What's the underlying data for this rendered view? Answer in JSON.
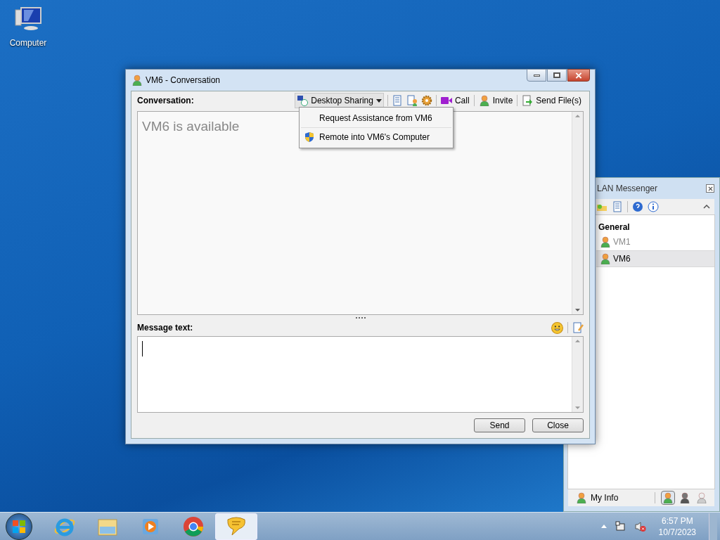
{
  "desktop_icons": [
    {
      "label": "Computer"
    }
  ],
  "messenger_window": {
    "title": "LAN Messenger",
    "group": "General",
    "contacts": [
      {
        "name": "VM1",
        "offline": true,
        "selected": false
      },
      {
        "name": "VM6",
        "offline": false,
        "selected": true
      }
    ],
    "my_info": "My Info",
    "statuses": [
      {
        "kind": "online",
        "selected": true
      },
      {
        "kind": "busy",
        "selected": false
      },
      {
        "kind": "offline",
        "selected": false
      }
    ]
  },
  "conversation_window": {
    "title": "VM6 - Conversation",
    "conversation_label": "Conversation:",
    "toolbar": {
      "desktop_sharing": "Desktop Sharing",
      "call": "Call",
      "invite": "Invite",
      "send_files": "Send File(s)"
    },
    "menu": [
      {
        "label": "Request Assistance from VM6",
        "kind": "plain"
      },
      {
        "label": "Remote into VM6's Computer",
        "kind": "shield"
      }
    ],
    "status_text": "VM6 is available",
    "message_label": "Message text:",
    "buttons": [
      "Send",
      "Close"
    ]
  },
  "taskbar": {
    "apps": [
      {
        "kind": "ie",
        "selected": false
      },
      {
        "kind": "explorer",
        "selected": false
      },
      {
        "kind": "media",
        "selected": false
      },
      {
        "kind": "chrome",
        "selected": false
      },
      {
        "kind": "messenger",
        "selected": true
      }
    ],
    "time": "6:57 PM",
    "date": "10/7/2023"
  }
}
